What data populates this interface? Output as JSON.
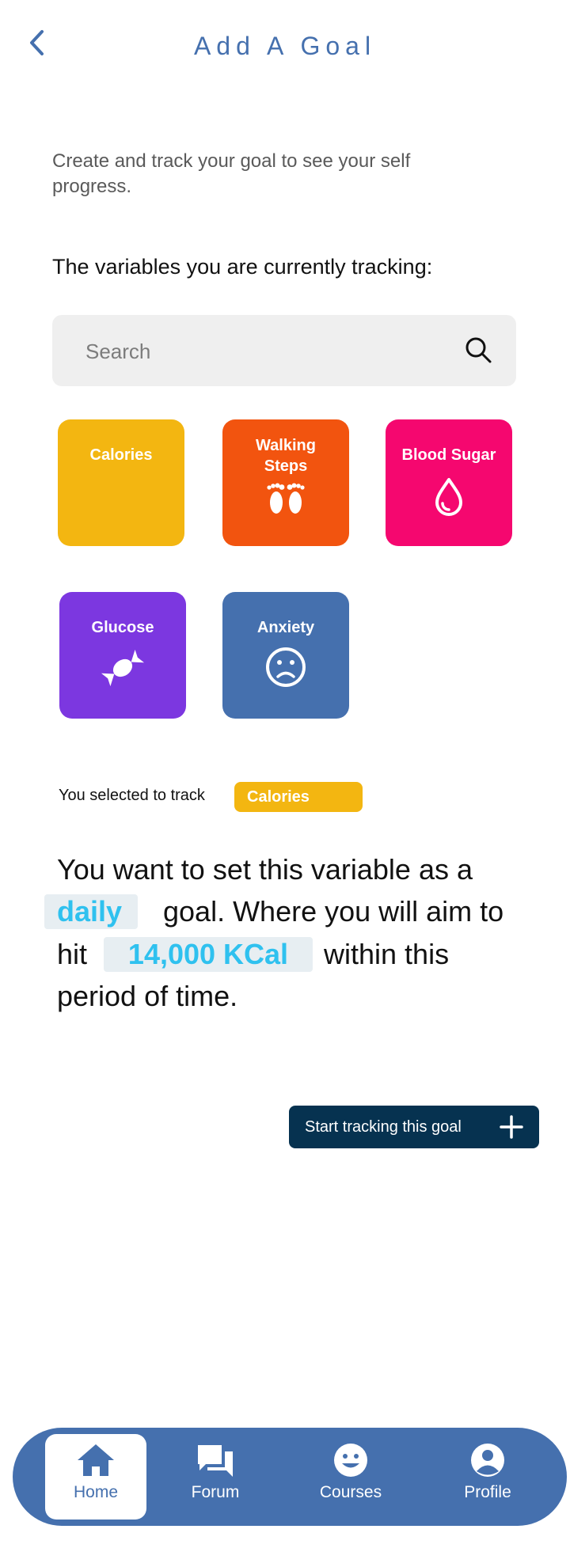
{
  "header": {
    "title": "Add A Goal",
    "back_icon": "chevron-left-icon"
  },
  "intro": "Create and track your goal to see your self progress.",
  "section_heading": "The variables you are currently tracking:",
  "search": {
    "placeholder": "Search",
    "icon": "search-icon"
  },
  "variables": [
    {
      "label": "Calories",
      "color": "#f3b611",
      "icon": "none"
    },
    {
      "label": "Walking Steps",
      "color": "#f2540f",
      "icon": "footprints-icon"
    },
    {
      "label": "Blood Sugar",
      "color": "#f5076f",
      "icon": "droplet-icon"
    },
    {
      "label": "Glucose",
      "color": "#7c37e0",
      "icon": "candy-icon"
    },
    {
      "label": "Anxiety",
      "color": "#4570ae",
      "icon": "sad-face-icon"
    }
  ],
  "selection": {
    "prefix": "You selected to track",
    "value": "Calories",
    "color": "#f3b611"
  },
  "goal_sentence": {
    "part1": "You want to set this variable as a",
    "period": "daily",
    "part2": "goal. Where you will aim to",
    "part3": "hit",
    "target": "14,000 KCal",
    "part4": "within this",
    "part5": "period of time."
  },
  "start_button": {
    "label": "Start tracking this goal",
    "icon": "plus-icon"
  },
  "bottom_nav": {
    "background": "#4570ae",
    "items": [
      {
        "label": "Home",
        "icon": "home-icon",
        "active": true
      },
      {
        "label": "Forum",
        "icon": "forum-icon",
        "active": false
      },
      {
        "label": "Courses",
        "icon": "smiley-icon",
        "active": false
      },
      {
        "label": "Profile",
        "icon": "profile-icon",
        "active": false
      }
    ]
  }
}
